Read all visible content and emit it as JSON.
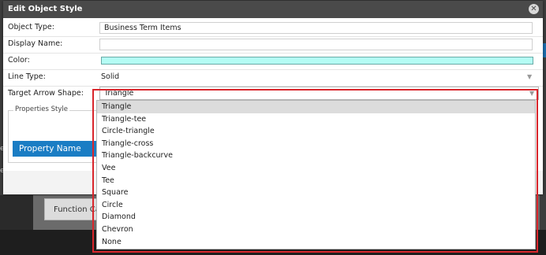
{
  "background": {
    "function_button_label": "Function Calls",
    "edge_text_left": "e",
    "edge_text_left2": "e"
  },
  "dialog": {
    "title": "Edit Object Style",
    "close_icon": "close-icon",
    "fields": {
      "object_type": {
        "label": "Object Type:",
        "value": "Business Term Items"
      },
      "display_name": {
        "label": "Display Name:",
        "value": ""
      },
      "color": {
        "label": "Color:",
        "value": "#b4fcf4"
      },
      "line_type": {
        "label": "Line Type:",
        "value": "Solid"
      },
      "target_arrow_shape": {
        "label": "Target Arrow Shape:",
        "value": "Triangle"
      }
    },
    "properties_style": {
      "legend": "Properties Style",
      "property_name_button": "Property Name"
    }
  },
  "dropdown": {
    "selected": "Triangle",
    "options": [
      "Triangle",
      "Triangle-tee",
      "Circle-triangle",
      "Triangle-cross",
      "Triangle-backcurve",
      "Vee",
      "Tee",
      "Square",
      "Circle",
      "Diamond",
      "Chevron",
      "None"
    ]
  },
  "colors": {
    "accent": "#1a7dc4",
    "highlight": "#d9262c",
    "titlebar": "#4a4a4a",
    "swatch": "#b4fcf4"
  }
}
